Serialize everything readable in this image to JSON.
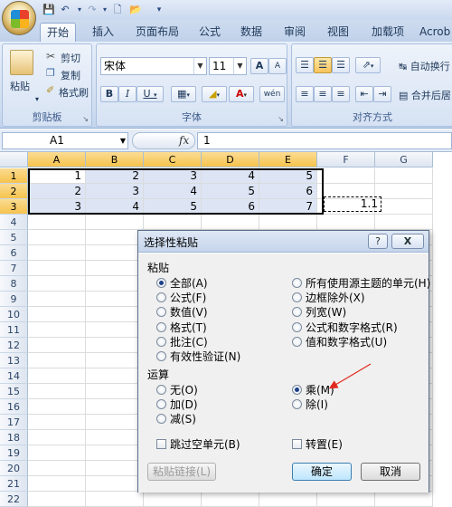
{
  "quick_access": {
    "save": "save-icon",
    "undo": "undo-icon",
    "redo": "redo-icon",
    "new": "new-icon",
    "open": "open-icon"
  },
  "tabs": [
    {
      "label": "开始",
      "active": true
    },
    {
      "label": "插入"
    },
    {
      "label": "页面布局"
    },
    {
      "label": "公式"
    },
    {
      "label": "数据"
    },
    {
      "label": "审阅"
    },
    {
      "label": "视图"
    },
    {
      "label": "加载项"
    },
    {
      "label": "Acrob"
    }
  ],
  "ribbon": {
    "clipboard": {
      "paste": "粘贴",
      "cut": "剪切",
      "copy": "复制",
      "format_painter": "格式刷",
      "group_label": "剪贴板"
    },
    "font": {
      "font_name": "宋体",
      "font_size": "11",
      "grow": "A",
      "shrink": "A",
      "bold": "B",
      "italic": "I",
      "underline": "U",
      "font_color_label": "A",
      "phonetic": "wén",
      "group_label": "字体"
    },
    "alignment": {
      "wrap_text": "自动换行",
      "merge_center": "合并后居",
      "group_label": "对齐方式"
    }
  },
  "formula_bar": {
    "name_box": "A1",
    "fx": "fx",
    "value": "1"
  },
  "columns": [
    "A",
    "B",
    "C",
    "D",
    "E",
    "F",
    "G"
  ],
  "rows": [
    "1",
    "2",
    "3",
    "4",
    "5",
    "6",
    "7",
    "8",
    "9",
    "10",
    "11",
    "12",
    "13",
    "14",
    "15",
    "16",
    "17",
    "18",
    "19",
    "20",
    "21",
    "22"
  ],
  "cells": [
    [
      "1",
      "2",
      "3",
      "4",
      "5"
    ],
    [
      "2",
      "3",
      "4",
      "5",
      "6"
    ],
    [
      "3",
      "4",
      "5",
      "6",
      "7"
    ]
  ],
  "copy_cell_value": "1.1",
  "dialog": {
    "title": "选择性粘贴",
    "help": "?",
    "close": "X",
    "paste_section": "粘贴",
    "paste_left": [
      "全部(A)",
      "公式(F)",
      "数值(V)",
      "格式(T)",
      "批注(C)",
      "有效性验证(N)"
    ],
    "paste_right": [
      "所有使用源主题的单元(H)",
      "边框除外(X)",
      "列宽(W)",
      "公式和数字格式(R)",
      "值和数字格式(U)"
    ],
    "operation_section": "运算",
    "operation_left": [
      "无(O)",
      "加(D)",
      "减(S)"
    ],
    "operation_right": [
      "乘(M)",
      "除(I)"
    ],
    "skip_blanks": "跳过空单元(B)",
    "transpose": "转置(E)",
    "paste_link": "粘贴链接(L)",
    "ok": "确定",
    "cancel": "取消",
    "selected_paste": "全部(A)",
    "selected_operation": "乘(M)"
  },
  "annotation_color": "#e0281e"
}
